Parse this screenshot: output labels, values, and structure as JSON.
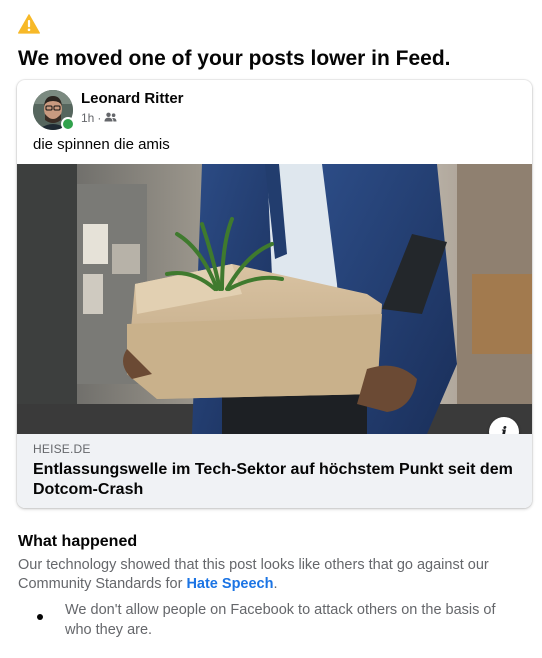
{
  "notice": {
    "icon": "warning-icon",
    "icon_color": "#f7b928",
    "headline": "We moved one of your posts lower in Feed."
  },
  "post": {
    "author": "Leonard Ritter",
    "time": "1h",
    "separator": "·",
    "audience_icon": "friends-icon",
    "online": true,
    "text": "die spinnen die amis",
    "image_icon": "office-worker-carrying-box-image",
    "link": {
      "domain": "HEISE.DE",
      "title": "Entlassungswelle im Tech-Sektor auf höchstem Punkt seit dem Dotcom-Crash"
    }
  },
  "details": {
    "title": "What happened",
    "explanation_before": "Our technology showed that this post looks like others that go against our Community Standards for ",
    "explanation_link": "Hate Speech",
    "explanation_after": ".",
    "bullets": [
      "We don't allow people on Facebook to attack others on the basis of who they are."
    ]
  },
  "colors": {
    "link_blue": "#1b74e4",
    "secondary_text": "#65676b",
    "online_green": "#31a24c",
    "preview_bg": "#f0f2f5"
  }
}
